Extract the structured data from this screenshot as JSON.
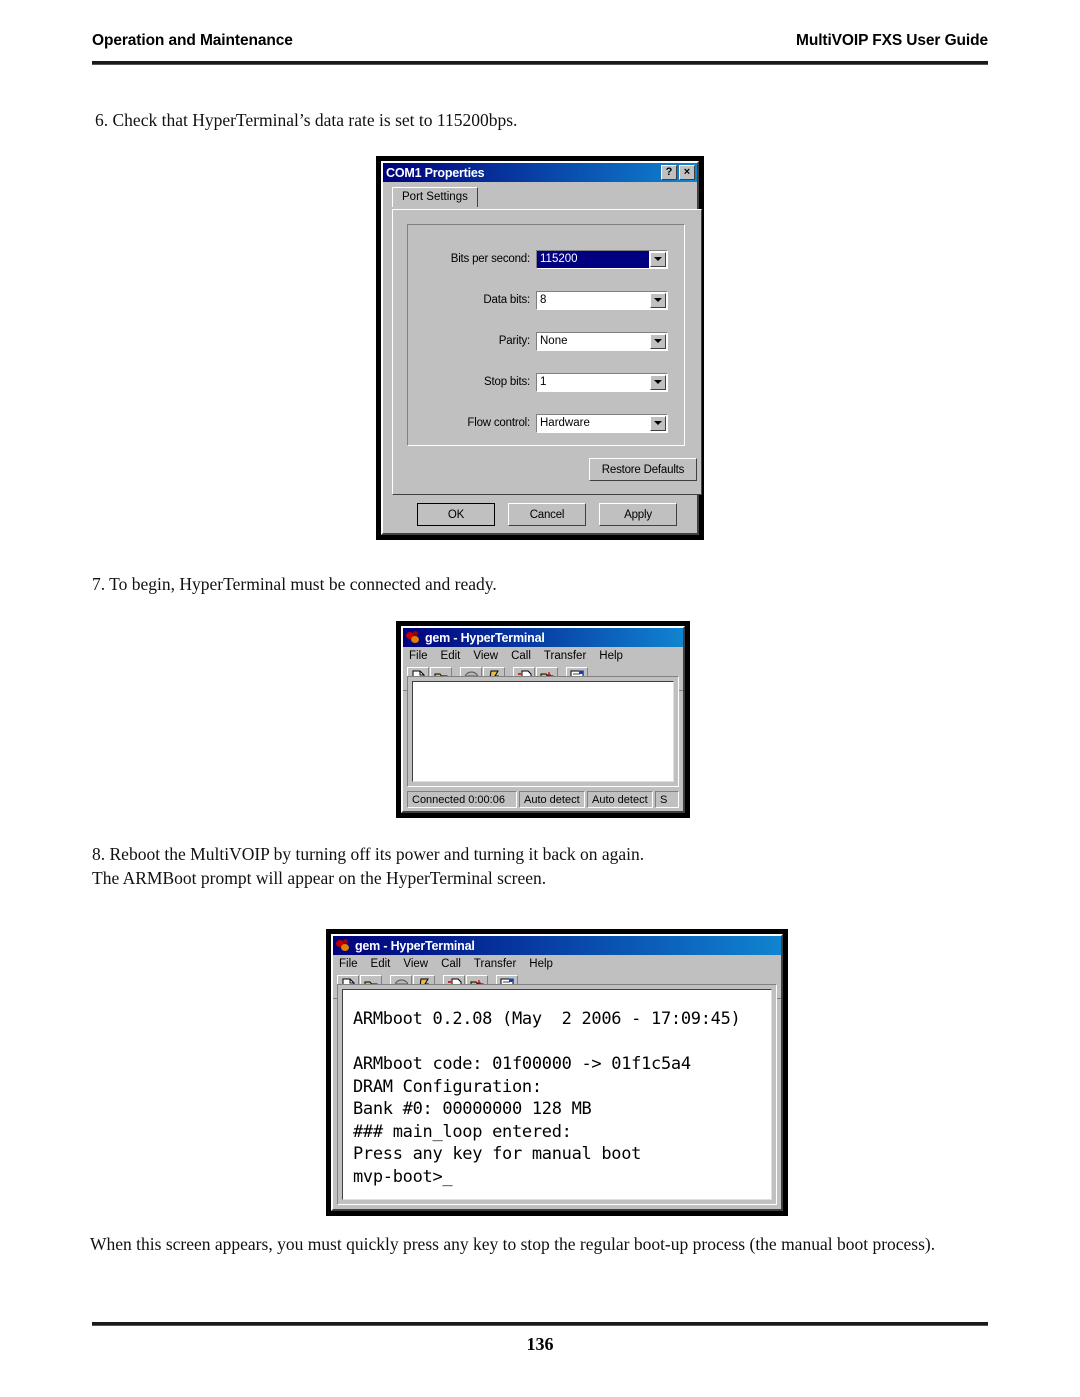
{
  "header": {
    "left": "Operation and Maintenance",
    "right": "MultiVOIP FXS User Guide"
  },
  "steps": {
    "step6": "6. Check that HyperTerminal’s data rate is set to 115200bps.",
    "step7": "7. To begin, HyperTerminal must be connected and ready.",
    "step8": "8. Reboot the MultiVOIP by turning off its power and turning it back on again.\nThe ARMBoot prompt will appear on the HyperTerminal screen.",
    "closing": "When this screen appears, you must quickly press any key to stop the regular boot-up process (the manual boot process)."
  },
  "com1_dialog": {
    "title": "COM1 Properties",
    "help_button": "?",
    "close_button": "×",
    "tab": "Port Settings",
    "fields": [
      {
        "label": "Bits per second:",
        "value": "115200",
        "selected": true
      },
      {
        "label": "Data bits:",
        "value": "8",
        "selected": false
      },
      {
        "label": "Parity:",
        "value": "None",
        "selected": false
      },
      {
        "label": "Stop bits:",
        "value": "1",
        "selected": false
      },
      {
        "label": "Flow control:",
        "value": "Hardware",
        "selected": false
      }
    ],
    "restore_defaults": "Restore Defaults",
    "ok": "OK",
    "cancel": "Cancel",
    "apply": "Apply"
  },
  "hyperterminal": {
    "title": "gem - HyperTerminal",
    "menus": [
      "File",
      "Edit",
      "View",
      "Call",
      "Transfer",
      "Help"
    ],
    "toolbar_icons": [
      "new-connection-icon",
      "open-file-icon",
      "dial-icon",
      "disconnect-icon",
      "send-file-icon",
      "receive-file-icon",
      "properties-icon"
    ],
    "statusbar": {
      "connected": "Connected 0:00:06",
      "protocol": "Auto detect",
      "rate": "Auto detect",
      "extra": "S"
    },
    "screen_empty": "",
    "screen_boot": "ARMboot 0.2.08 (May  2 2006 - 17:09:45)\n\nARMboot code: 01f00000 -> 01f1c5a4\nDRAM Configuration:\nBank #0: 00000000 128 MB\n### main_loop entered:\nPress any key for manual boot\nmvp-boot>_"
  },
  "footer": {
    "page_number": "136"
  },
  "colors": {
    "title_gradient_start": "#00007b",
    "title_gradient_end": "#1084d0",
    "window_face": "#c0c0c0",
    "selection_blue": "#000080"
  }
}
